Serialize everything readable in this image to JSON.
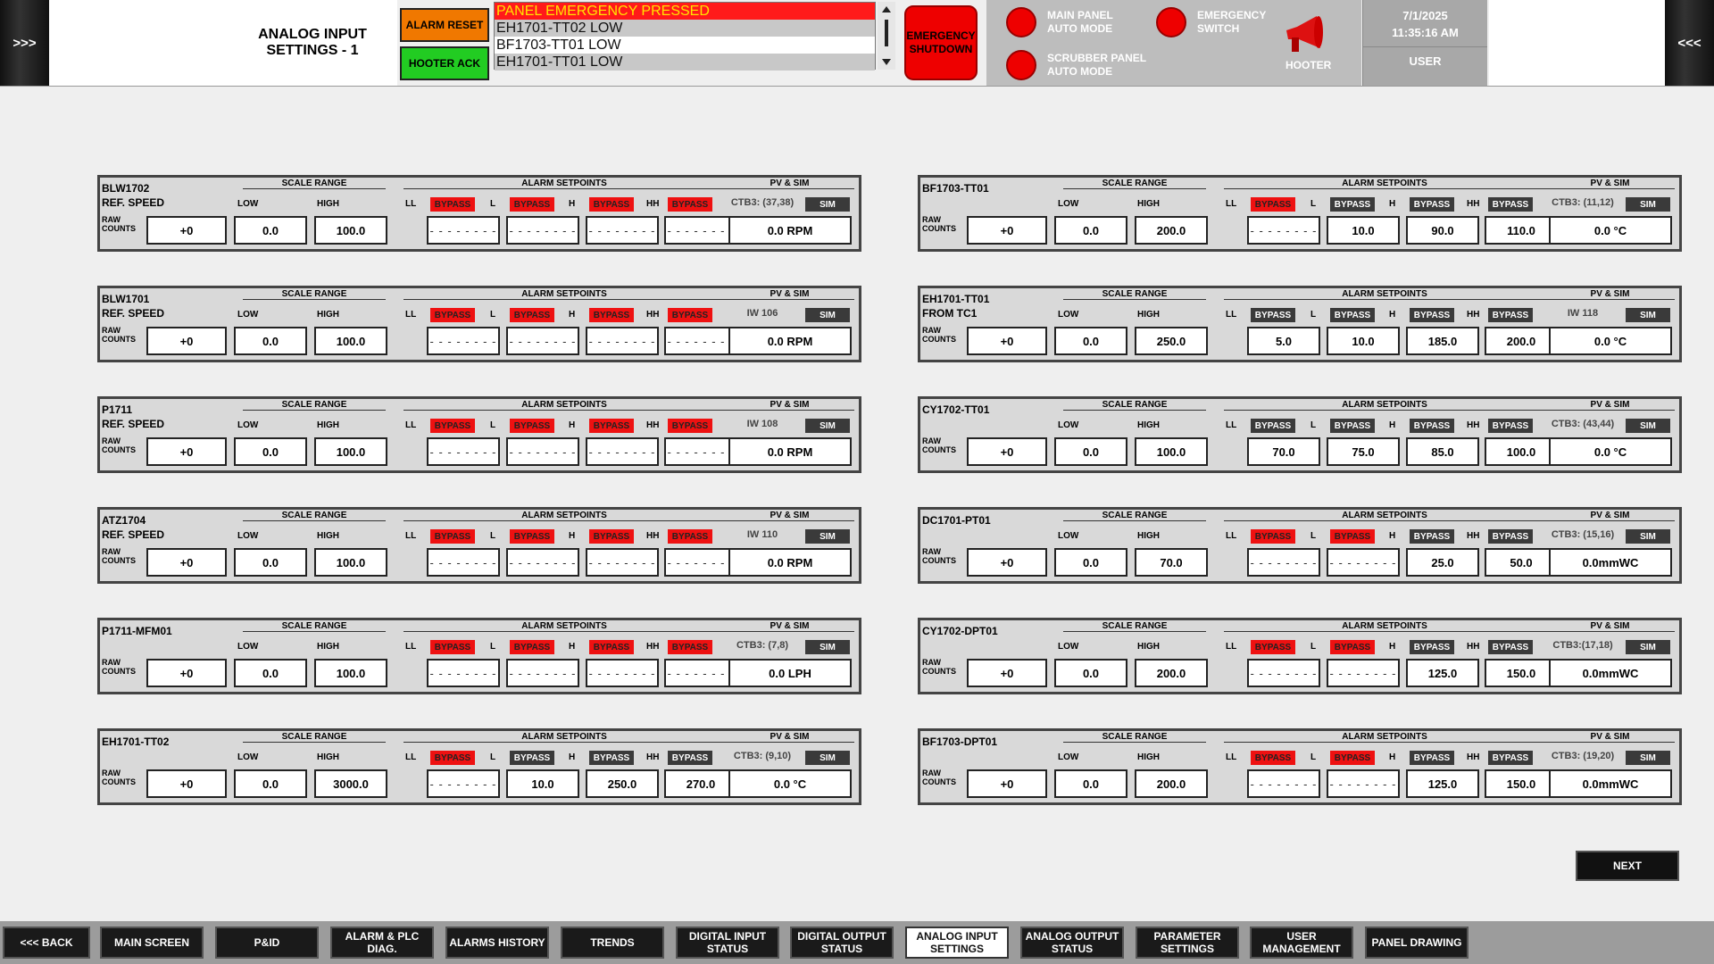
{
  "header": {
    "left_nav": ">>>",
    "right_nav": "<<<",
    "title_line1": "ANALOG INPUT",
    "title_line2": "SETTINGS - 1",
    "alarm_reset": "ALARM RESET",
    "hooter_ack": "HOOTER ACK",
    "alarms": [
      "PANEL EMERGENCY PRESSED",
      "EH1701-TT02 LOW",
      "BF1703-TT01 LOW",
      "EH1701-TT01 LOW"
    ],
    "emergency_shutdown": "EMERGENCY SHUTDOWN",
    "main_panel": "MAIN PANEL AUTO MODE",
    "emergency_switch": "EMERGENCY SWITCH",
    "scrubber_panel": "SCRUBBER PANEL AUTO MODE",
    "hooter": "HOOTER",
    "date": "7/1/2025",
    "time": "11:35:16 AM",
    "user": "USER"
  },
  "labels": {
    "scale_range": "SCALE RANGE",
    "alarm_setpoints": "ALARM SETPOINTS",
    "pv_sim": "PV & SIM",
    "low": "LOW",
    "high": "HIGH",
    "ll": "LL",
    "l": "L",
    "h": "H",
    "hh": "HH",
    "bypass": "BYPASS",
    "sim": "SIM",
    "raw_counts": "RAW COUNTS",
    "dash": "- - - - - - - -"
  },
  "panels": [
    {
      "tag": "BLW1702",
      "sub": "REF. SPEED",
      "raw": "+0",
      "low": "0.0",
      "high": "100.0",
      "sp": [
        "",
        "",
        "",
        ""
      ],
      "bp": [
        "red",
        "red",
        "red",
        "red"
      ],
      "addr": "CTB3: (37,38)",
      "pv": "0.0 RPM"
    },
    {
      "tag": "BLW1701",
      "sub": "REF. SPEED",
      "raw": "+0",
      "low": "0.0",
      "high": "100.0",
      "sp": [
        "",
        "",
        "",
        ""
      ],
      "bp": [
        "red",
        "red",
        "red",
        "red"
      ],
      "addr": "IW 106",
      "pv": "0.0 RPM"
    },
    {
      "tag": "P1711",
      "sub": "REF. SPEED",
      "raw": "+0",
      "low": "0.0",
      "high": "100.0",
      "sp": [
        "",
        "",
        "",
        ""
      ],
      "bp": [
        "red",
        "red",
        "red",
        "red"
      ],
      "addr": "IW 108",
      "pv": "0.0 RPM"
    },
    {
      "tag": "ATZ1704",
      "sub": "REF. SPEED",
      "raw": "+0",
      "low": "0.0",
      "high": "100.0",
      "sp": [
        "",
        "",
        "",
        ""
      ],
      "bp": [
        "red",
        "red",
        "red",
        "red"
      ],
      "addr": "IW 110",
      "pv": "0.0 RPM"
    },
    {
      "tag": "P1711-MFM01",
      "sub": "",
      "raw": "+0",
      "low": "0.0",
      "high": "100.0",
      "sp": [
        "",
        "",
        "",
        ""
      ],
      "bp": [
        "red",
        "red",
        "red",
        "red"
      ],
      "addr": "CTB3: (7,8)",
      "pv": "0.0 LPH"
    },
    {
      "tag": "EH1701-TT02",
      "sub": "",
      "raw": "+0",
      "low": "0.0",
      "high": "3000.0",
      "sp": [
        "",
        "10.0",
        "250.0",
        "270.0"
      ],
      "bp": [
        "red",
        "grey",
        "grey",
        "grey"
      ],
      "addr": "CTB3: (9,10)",
      "pv": "0.0 °C"
    },
    {
      "tag": "BF1703-TT01",
      "sub": "",
      "raw": "+0",
      "low": "0.0",
      "high": "200.0",
      "sp": [
        "",
        "10.0",
        "90.0",
        "110.0"
      ],
      "bp": [
        "red",
        "grey",
        "grey",
        "grey"
      ],
      "addr": "CTB3: (11,12)",
      "pv": "0.0 °C"
    },
    {
      "tag": "EH1701-TT01",
      "sub": "FROM TC1",
      "raw": "+0",
      "low": "0.0",
      "high": "250.0",
      "sp": [
        "5.0",
        "10.0",
        "185.0",
        "200.0"
      ],
      "bp": [
        "grey",
        "grey",
        "grey",
        "grey"
      ],
      "addr": "IW 118",
      "pv": "0.0 °C"
    },
    {
      "tag": "CY1702-TT01",
      "sub": "",
      "raw": "+0",
      "low": "0.0",
      "high": "100.0",
      "sp": [
        "70.0",
        "75.0",
        "85.0",
        "100.0"
      ],
      "bp": [
        "grey",
        "grey",
        "grey",
        "grey"
      ],
      "addr": "CTB3: (43,44)",
      "pv": "0.0 °C"
    },
    {
      "tag": "DC1701-PT01",
      "sub": "",
      "raw": "+0",
      "low": "0.0",
      "high": "70.0",
      "sp": [
        "",
        "",
        "25.0",
        "50.0"
      ],
      "bp": [
        "red",
        "red",
        "grey",
        "grey"
      ],
      "addr": "CTB3: (15,16)",
      "pv": "0.0mmWC"
    },
    {
      "tag": "CY1702-DPT01",
      "sub": "",
      "raw": "+0",
      "low": "0.0",
      "high": "200.0",
      "sp": [
        "",
        "",
        "125.0",
        "150.0"
      ],
      "bp": [
        "red",
        "red",
        "grey",
        "grey"
      ],
      "addr": "CTB3:(17,18)",
      "pv": "0.0mmWC"
    },
    {
      "tag": "BF1703-DPT01",
      "sub": "",
      "raw": "+0",
      "low": "0.0",
      "high": "200.0",
      "sp": [
        "",
        "",
        "125.0",
        "150.0"
      ],
      "bp": [
        "red",
        "red",
        "grey",
        "grey"
      ],
      "addr": "CTB3: (19,20)",
      "pv": "0.0mmWC"
    }
  ],
  "next": "NEXT",
  "footer": [
    "<<< BACK",
    "MAIN SCREEN",
    "P&ID",
    "ALARM & PLC DIAG.",
    "ALARMS HISTORY",
    "TRENDS",
    "DIGITAL INPUT STATUS",
    "DIGITAL OUTPUT STATUS",
    "ANALOG INPUT SETTINGS",
    "ANALOG OUTPUT STATUS",
    "PARAMETER SETTINGS",
    "USER MANAGEMENT",
    "PANEL DRAWING"
  ],
  "footer_active": 8,
  "colors": {
    "alarm_active": "#ee1111",
    "bypass_active": "#e11111",
    "bypass_inactive": "#3a3a3a"
  }
}
